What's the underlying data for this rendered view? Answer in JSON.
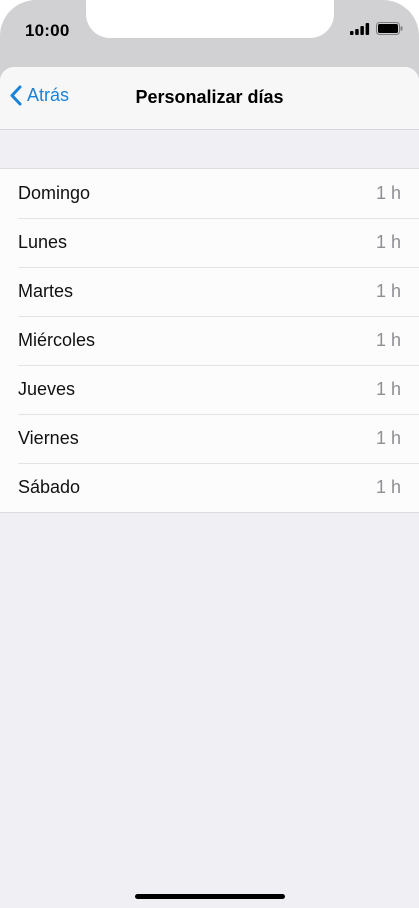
{
  "status_bar": {
    "time": "10:00",
    "icons": [
      "signal-icon",
      "battery-icon"
    ]
  },
  "navbar": {
    "back_label": "Atrás",
    "title": "Personalizar días"
  },
  "days": [
    {
      "label": "Domingo",
      "value": "1 h"
    },
    {
      "label": "Lunes",
      "value": "1 h"
    },
    {
      "label": "Martes",
      "value": "1 h"
    },
    {
      "label": "Miércoles",
      "value": "1 h"
    },
    {
      "label": "Jueves",
      "value": "1 h"
    },
    {
      "label": "Viernes",
      "value": "1 h"
    },
    {
      "label": "Sábado",
      "value": "1 h"
    }
  ],
  "colors": {
    "accent": "#1a82d8",
    "background": "#efeff4",
    "secondary_text": "#8e8e93"
  }
}
